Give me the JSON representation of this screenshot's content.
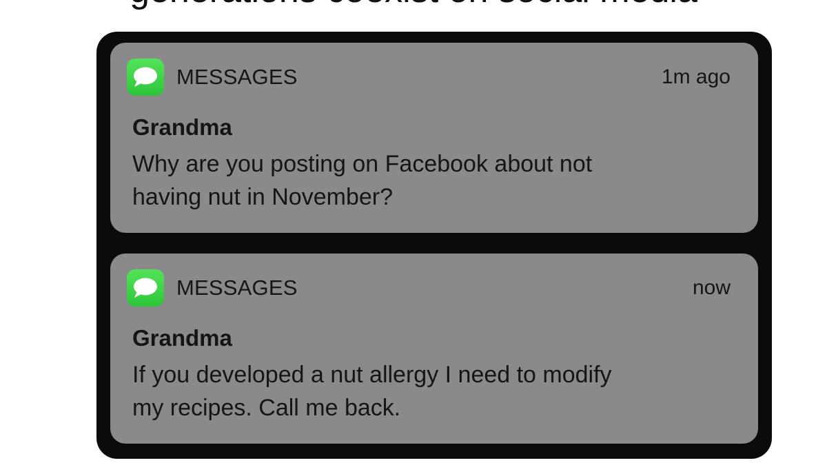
{
  "caption": "generations coexist on social media",
  "notifications": [
    {
      "app_name": "MESSAGES",
      "app_icon": "messages-bubble-icon",
      "time": "1m ago",
      "sender": "Grandma",
      "line1": "Why are you posting on Facebook about not",
      "line2": "having nut in November?"
    },
    {
      "app_name": "MESSAGES",
      "app_icon": "messages-bubble-icon",
      "time": "now",
      "sender": "Grandma",
      "line1": "If you developed a nut allergy I need to modify",
      "line2": "my recipes. Call me back."
    }
  ],
  "colors": {
    "frame": "#0b0b0b",
    "notification_bg": "#8b898c",
    "icon_green": "#3fd34a",
    "text": "#151515"
  }
}
